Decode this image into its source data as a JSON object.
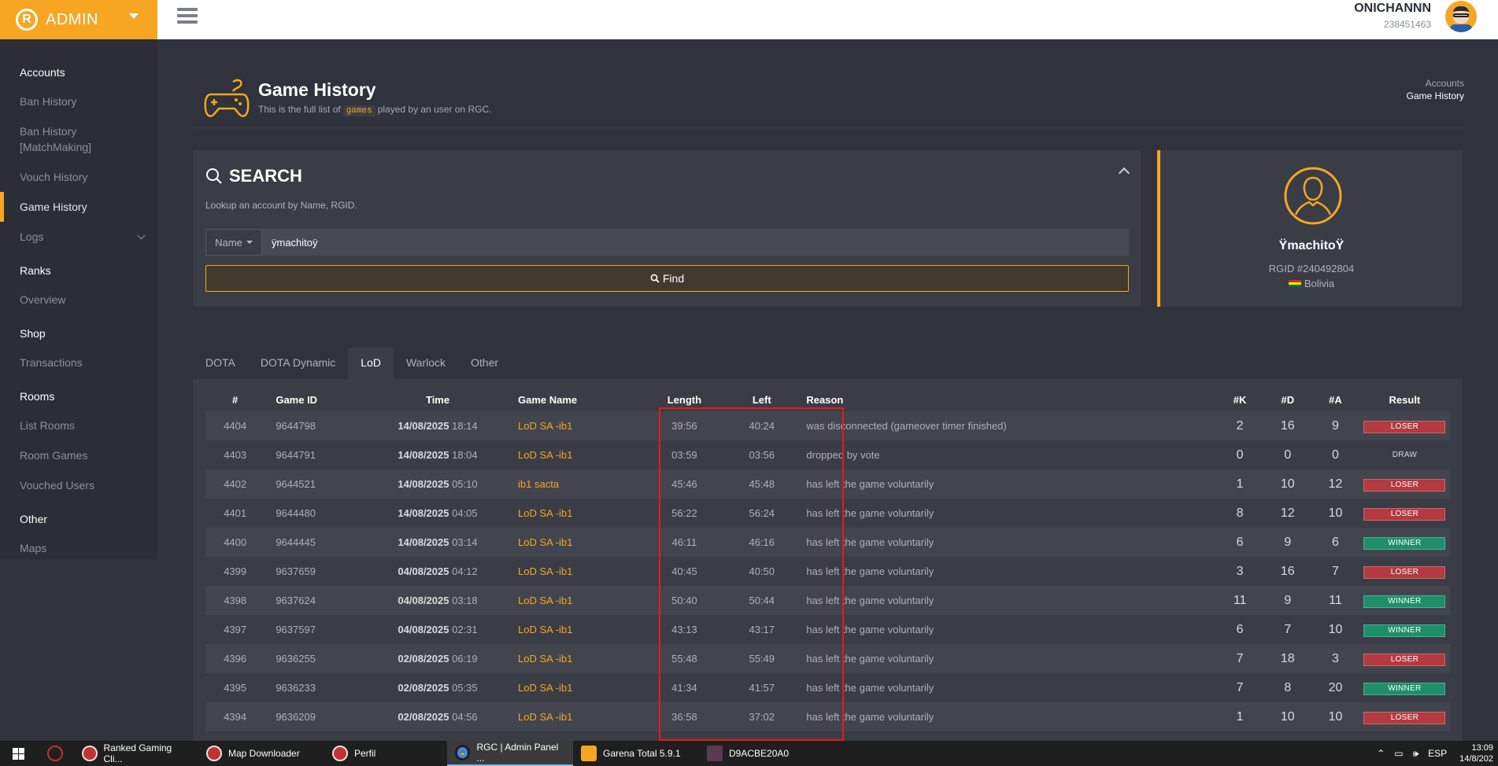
{
  "brand": {
    "name": "ADMIN",
    "logo": "R"
  },
  "user": {
    "name": "ONICHANNN",
    "id": "238451463"
  },
  "sidebar": {
    "sections": [
      {
        "title": "Accounts",
        "items": [
          "Ban History",
          "Ban History [MatchMaking]",
          "Vouch History",
          "Game History",
          "Logs"
        ]
      },
      {
        "title": "Ranks",
        "items": [
          "Overview"
        ]
      },
      {
        "title": "Shop",
        "items": [
          "Transactions"
        ]
      },
      {
        "title": "Rooms",
        "items": [
          "List Rooms",
          "Room Games",
          "Vouched Users"
        ]
      },
      {
        "title": "Other",
        "items": [
          "Maps"
        ]
      }
    ],
    "active": "Game History"
  },
  "page": {
    "title": "Game History",
    "subtitle_before": "This is the full list of",
    "subtitle_code": "games",
    "subtitle_after": "played by an user on RGC.",
    "breadcrumb": [
      "Accounts",
      "Game History"
    ]
  },
  "search": {
    "title": "SEARCH",
    "description": "Lookup an account by Name, RGID.",
    "type_label": "Name",
    "value": "ÿmachitoÿ",
    "find_label": "Find"
  },
  "profile": {
    "name": "ŸmachitoŸ",
    "rgid": "RGID #240492804",
    "country": "Bolivia",
    "flag_colors": [
      "#d52b1e",
      "#f9e300",
      "#007934"
    ]
  },
  "tabs": [
    "DOTA",
    "DOTA Dynamic",
    "LoD",
    "Warlock",
    "Other"
  ],
  "active_tab": "LoD",
  "table": {
    "headers": [
      "#",
      "Game ID",
      "Time",
      "Game Name",
      "Length",
      "Left",
      "Reason",
      "#K",
      "#D",
      "#A",
      "Result"
    ],
    "rows": [
      {
        "n": "4404",
        "id": "9644798",
        "date": "14/08/2025",
        "hour": "18:14",
        "name": "LoD SA -ib1",
        "length": "39:56",
        "left": "40:24",
        "reason": "was disconnected (gameover timer finished)",
        "k": "2",
        "d": "16",
        "a": "9",
        "result": "LOSER"
      },
      {
        "n": "4403",
        "id": "9644791",
        "date": "14/08/2025",
        "hour": "18:04",
        "name": "LoD SA -ib1",
        "length": "03:59",
        "left": "03:56",
        "reason": "dropped by vote",
        "k": "0",
        "d": "0",
        "a": "0",
        "result": "DRAW"
      },
      {
        "n": "4402",
        "id": "9644521",
        "date": "14/08/2025",
        "hour": "05:10",
        "name": "ib1 sacta",
        "length": "45:46",
        "left": "45:48",
        "reason": "has left the game voluntarily",
        "k": "1",
        "d": "10",
        "a": "12",
        "result": "LOSER"
      },
      {
        "n": "4401",
        "id": "9644480",
        "date": "14/08/2025",
        "hour": "04:05",
        "name": "LoD SA -ib1",
        "length": "56:22",
        "left": "56:24",
        "reason": "has left the game voluntarily",
        "k": "8",
        "d": "12",
        "a": "10",
        "result": "LOSER"
      },
      {
        "n": "4400",
        "id": "9644445",
        "date": "14/08/2025",
        "hour": "03:14",
        "name": "LoD SA -ib1",
        "length": "46:11",
        "left": "46:16",
        "reason": "has left the game voluntarily",
        "k": "6",
        "d": "9",
        "a": "6",
        "result": "WINNER"
      },
      {
        "n": "4399",
        "id": "9637659",
        "date": "04/08/2025",
        "hour": "04:12",
        "name": "LoD SA -ib1",
        "length": "40:45",
        "left": "40:50",
        "reason": "has left the game voluntarily",
        "k": "3",
        "d": "16",
        "a": "7",
        "result": "LOSER"
      },
      {
        "n": "4398",
        "id": "9637624",
        "date": "04/08/2025",
        "hour": "03:18",
        "name": "LoD SA -ib1",
        "length": "50:40",
        "left": "50:44",
        "reason": "has left the game voluntarily",
        "k": "11",
        "d": "9",
        "a": "11",
        "result": "WINNER"
      },
      {
        "n": "4397",
        "id": "9637597",
        "date": "04/08/2025",
        "hour": "02:31",
        "name": "LoD SA -ib1",
        "length": "43:13",
        "left": "43:17",
        "reason": "has left the game voluntarily",
        "k": "6",
        "d": "7",
        "a": "10",
        "result": "WINNER"
      },
      {
        "n": "4396",
        "id": "9636255",
        "date": "02/08/2025",
        "hour": "06:19",
        "name": "LoD SA -ib1",
        "length": "55:48",
        "left": "55:49",
        "reason": "has left the game voluntarily",
        "k": "7",
        "d": "18",
        "a": "3",
        "result": "LOSER"
      },
      {
        "n": "4395",
        "id": "9636233",
        "date": "02/08/2025",
        "hour": "05:35",
        "name": "LoD SA -ib1",
        "length": "41:34",
        "left": "41:57",
        "reason": "has left the game voluntarily",
        "k": "7",
        "d": "8",
        "a": "20",
        "result": "WINNER"
      },
      {
        "n": "4394",
        "id": "9636209",
        "date": "02/08/2025",
        "hour": "04:56",
        "name": "LoD SA -ib1",
        "length": "36:58",
        "left": "37:02",
        "reason": "has left the game voluntarily",
        "k": "1",
        "d": "10",
        "a": "10",
        "result": "LOSER"
      }
    ]
  },
  "taskbar": {
    "items": [
      {
        "label": "",
        "icon": "rgc-tray-icon"
      },
      {
        "label": "Ranked Gaming Cli...",
        "icon": "rgc-icon"
      },
      {
        "label": "Map Downloader",
        "icon": "rgc-icon"
      },
      {
        "label": "Perfil",
        "icon": "rgc-icon"
      },
      {
        "label": "RGC | Admin Panel ...",
        "icon": "chrome-icon"
      },
      {
        "label": "Garena Total 5.9.1",
        "icon": "garena-icon"
      },
      {
        "label": "D9ACBE20A0",
        "icon": "dota-icon"
      }
    ],
    "language": "ESP",
    "time": "13:09",
    "date": "14/8/202"
  },
  "colors": {
    "accent": "#f6a623",
    "loser": "#b33a40",
    "winner": "#1d8f6a",
    "highlight": "#e31b1b"
  }
}
